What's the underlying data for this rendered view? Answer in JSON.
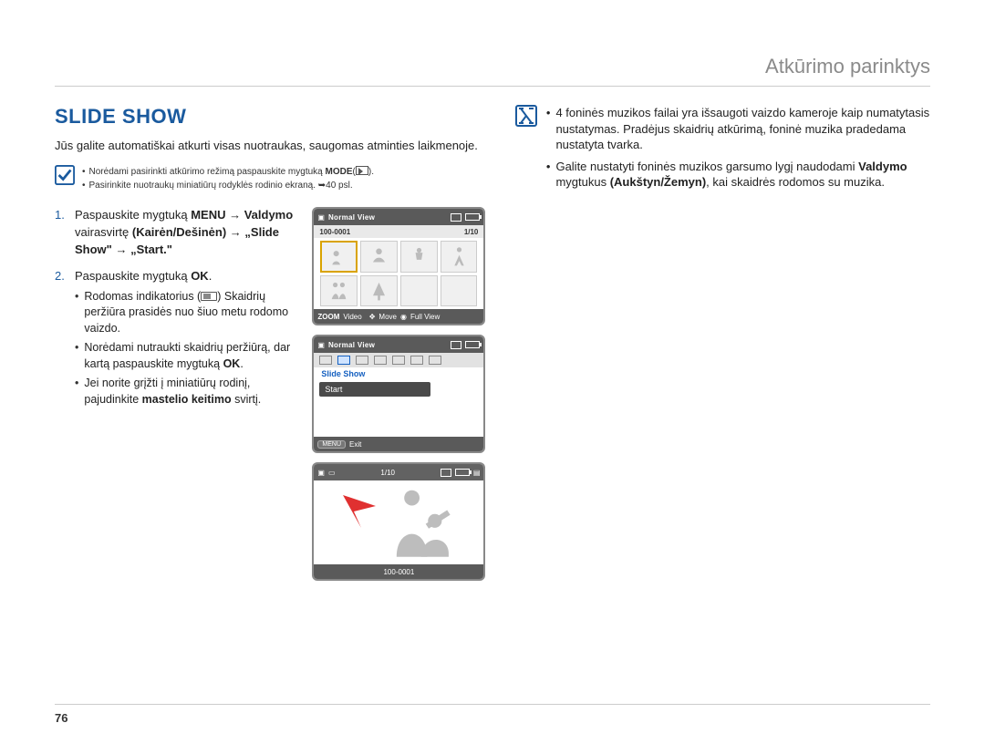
{
  "header": {
    "breadcrumb": "Atkūrimo parinktys"
  },
  "section": {
    "title": "SLIDE SHOW"
  },
  "intro": "Jūs galite automatiškai atkurti visas nuotraukas, saugomas atminties laikmenoje.",
  "prenote": {
    "line1_a": "Norėdami pasirinkti atkūrimo režimą paspauskite mygtuką ",
    "line1_bold": "MODE",
    "line1_b": "(",
    "line1_c": ").",
    "line2": "Pasirinkite nuotraukų miniatiūrų rodyklės rodinio ekraną. ➥40 psl."
  },
  "steps": {
    "s1_a": "Paspauskite mygtuką ",
    "s1_menu": "MENU",
    "s1_b": " → ",
    "s1_valdymo": "Valdymo",
    "s1_c": " vairasvirtę ",
    "s1_kd": "(Kairėn/Dešinėn)",
    "s1_d": " → ",
    "s1_slide": "„Slide Show\"",
    "s1_e": " → ",
    "s1_start": "„Start.\"",
    "s2_a": "Paspauskite mygtuką ",
    "s2_ok": "OK",
    "s2_b": ".",
    "s2_sub1_a": "Rodomas indikatorius (",
    "s2_sub1_b": ") Skaidrių peržiūra prasidės nuo šiuo metu rodomo vaizdo.",
    "s2_sub2_a": "Norėdami nutraukti skaidrių peržiūrą, dar kartą paspauskite mygtuką ",
    "s2_sub2_ok": "OK",
    "s2_sub2_b": ".",
    "s2_sub3_a": "Jei norite grįžti į miniatiūrų rodinį, pajudinkite ",
    "s2_sub3_bold": "mastelio keitimo",
    "s2_sub3_b": " svirtį."
  },
  "rightnote": {
    "li1": "4 foninės muzikos failai yra išsaugoti vaizdo kameroje kaip numatytasis nustatymas. Pradėjus skaidrių atkūrimą, foninė muzika pradedama nustatyta tvarka.",
    "li2_a": "Galite nustatyti foninės muzikos garsumo lygį naudodami ",
    "li2_bold1": "Valdymo",
    "li2_b": " mygtukus ",
    "li2_bold2": "(Aukštyn/Žemyn)",
    "li2_c": ", kai skaidrės rodomos su muzika."
  },
  "lcd1": {
    "topbar_title": "Normal View",
    "sub_left": "100-0001",
    "sub_right": "1/10",
    "bottom_zoom": "ZOOM",
    "bottom_video": "Video",
    "bottom_move": "Move",
    "bottom_full": "Full View"
  },
  "lcd2": {
    "topbar_title": "Normal View",
    "menu_title": "Slide Show",
    "menu_item": "Start",
    "bottom_menu": "MENU",
    "bottom_exit": "Exit"
  },
  "lcd3": {
    "top_counter": "1/10",
    "bottom_id": "100-0001"
  },
  "footer": {
    "page": "76"
  }
}
